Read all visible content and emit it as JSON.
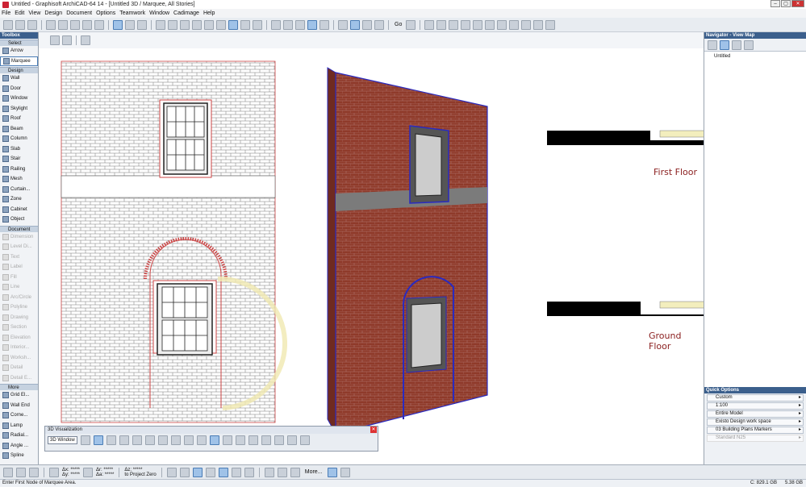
{
  "app": {
    "title": "Untitled - Graphisoft ArchiCAD-64 14 - [Untitled 3D / Marquee, All Stories]"
  },
  "menu": [
    "File",
    "Edit",
    "View",
    "Design",
    "Document",
    "Options",
    "Teamwork",
    "Window",
    "Cadimage",
    "Help"
  ],
  "toolbar": {
    "go_label": "Go"
  },
  "toolbox": {
    "title": "Toolbox",
    "select_label": "Select",
    "arrow": "Arrow",
    "marquee": "Marquee",
    "design_section": "Design",
    "design_items": [
      "Wall",
      "Door",
      "Window",
      "Skylight",
      "Roof",
      "Beam",
      "Column",
      "Slab",
      "Stair",
      "Railing",
      "Mesh",
      "Curtain...",
      "Zone",
      "Cabinet",
      "Object"
    ],
    "document_section": "Document",
    "document_items": [
      "Dimension",
      "Level Di...",
      "Text",
      "Label",
      "Fill",
      "Line",
      "Arc/Circle",
      "Polyline",
      "Drawing",
      "Section",
      "Elevation",
      "Interior...",
      "Worksh...",
      "Detail",
      "Detail E..."
    ],
    "more_section": "More",
    "more_items": [
      "Grid El...",
      "Wall End",
      "Corne...",
      "Lamp",
      "Radial...",
      "Angle ...",
      "Spline"
    ]
  },
  "navigator": {
    "title": "Navigator - View Map",
    "tree_item": "Untitled"
  },
  "quick_options": {
    "title": "Quick Options",
    "items": [
      "Custom",
      "1:100",
      "Entire Model",
      "Existo Design work space",
      "03 Building Plans Markers",
      "Standard N25"
    ]
  },
  "canvas": {
    "first_floor": "First Floor",
    "ground_floor": "Ground Floor"
  },
  "viz": {
    "title": "3D Visualization",
    "button": "3D Window"
  },
  "coord": {
    "dx": "Δx: *****",
    "dy": "Δy: *****",
    "da": "Δr: *****",
    "db": "Δa: *****",
    "dz": "Δz: *****",
    "ref": "to Project Zero",
    "more": "More..."
  },
  "status": {
    "message": "Enter First Node of Marquee Area.",
    "disk1": "C: 829.1 GB",
    "disk2": "5.38 GB"
  }
}
